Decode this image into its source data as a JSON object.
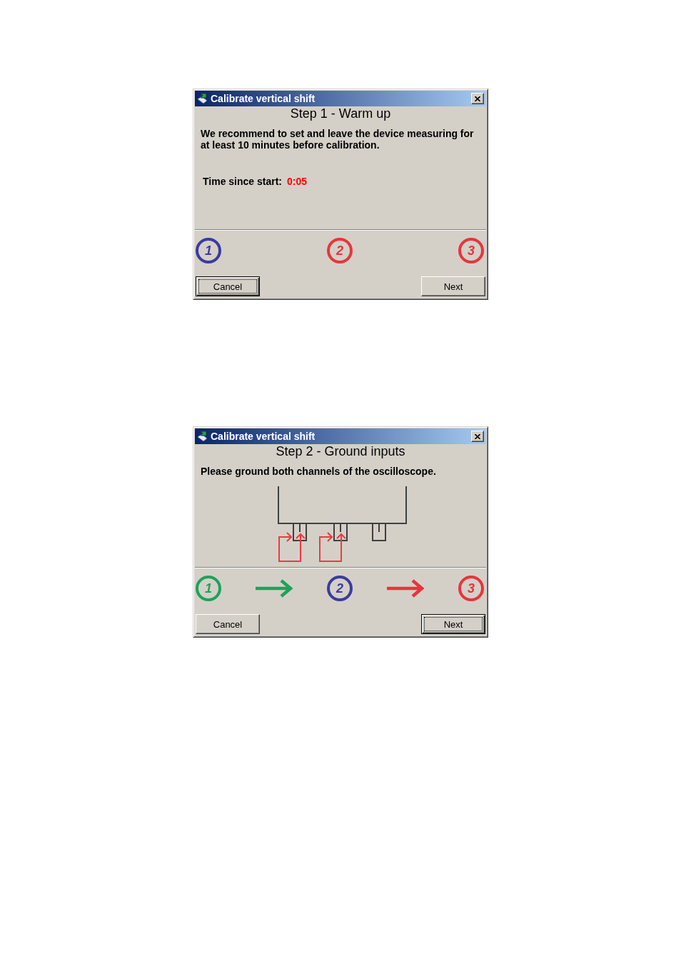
{
  "dialogs": [
    {
      "window": {
        "title": "Calibrate vertical shift"
      },
      "step_title": "Step 1 - Warm up",
      "message": "We recommend to set and leave the device measuring for at least 10 minutes before calibration.",
      "timer": {
        "label": "Time since start:",
        "value": "0:05"
      },
      "steps": [
        {
          "kind": "circle",
          "label": "1",
          "color": "#3b3b9e"
        },
        {
          "kind": "circle",
          "label": "2",
          "color": "#e8343c"
        },
        {
          "kind": "circle",
          "label": "3",
          "color": "#e8343c"
        }
      ],
      "buttons": [
        {
          "label": "Cancel",
          "focused": true
        },
        {
          "label": "Next",
          "focused": false
        }
      ]
    },
    {
      "window": {
        "title": "Calibrate vertical shift"
      },
      "step_title": "Step 2 - Ground inputs",
      "message": "Please ground both channels of the oscilloscope.",
      "diagram": {
        "inputs": [
          {
            "grounded": true
          },
          {
            "grounded": true
          },
          {
            "grounded": false
          }
        ]
      },
      "steps": [
        {
          "kind": "circle",
          "label": "1",
          "color": "#1ca35a"
        },
        {
          "kind": "arrow",
          "color": "#1ca35a"
        },
        {
          "kind": "circle",
          "label": "2",
          "color": "#3b3b9e"
        },
        {
          "kind": "arrow",
          "color": "#e8343c"
        },
        {
          "kind": "circle",
          "label": "3",
          "color": "#e8343c"
        }
      ],
      "buttons": [
        {
          "label": "Cancel",
          "focused": false
        },
        {
          "label": "Next",
          "focused": true
        }
      ]
    }
  ]
}
